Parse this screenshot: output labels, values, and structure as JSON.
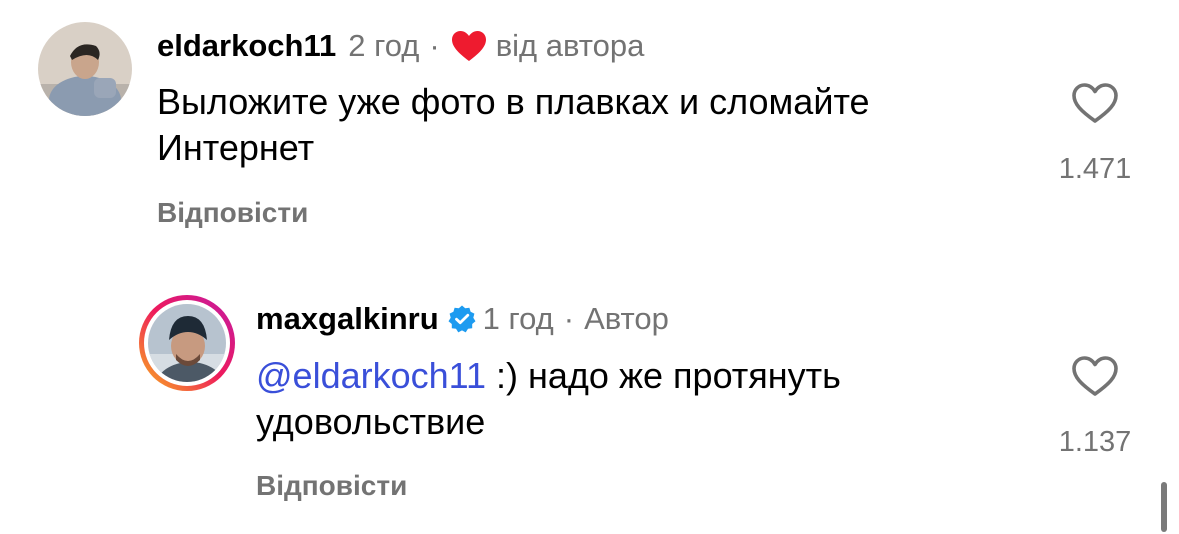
{
  "comments": [
    {
      "username": "eldarkoch11",
      "time": "2 год",
      "separator": "·",
      "badge": "від автора",
      "text": "Выложите уже фото в плавках и сломайте Интернет",
      "reply_label": "Відповісти",
      "like_count": "1.471"
    },
    {
      "username": "maxgalkinru",
      "verified": true,
      "time": "1 год",
      "separator": "·",
      "badge": "Автор",
      "mention": "@eldarkoch11",
      "text": " :) надо же протянуть удовольствие",
      "reply_label": "Відповісти",
      "like_count": "1.137"
    }
  ],
  "colors": {
    "heart_badge": "#ee1b2f",
    "verified": "#1d9bf0",
    "mention": "#3a4fd9",
    "secondary_text": "#737373"
  },
  "icons": {
    "author_like": "heart-filled-icon",
    "like": "heart-outline-icon",
    "verified": "verified-badge-icon"
  }
}
